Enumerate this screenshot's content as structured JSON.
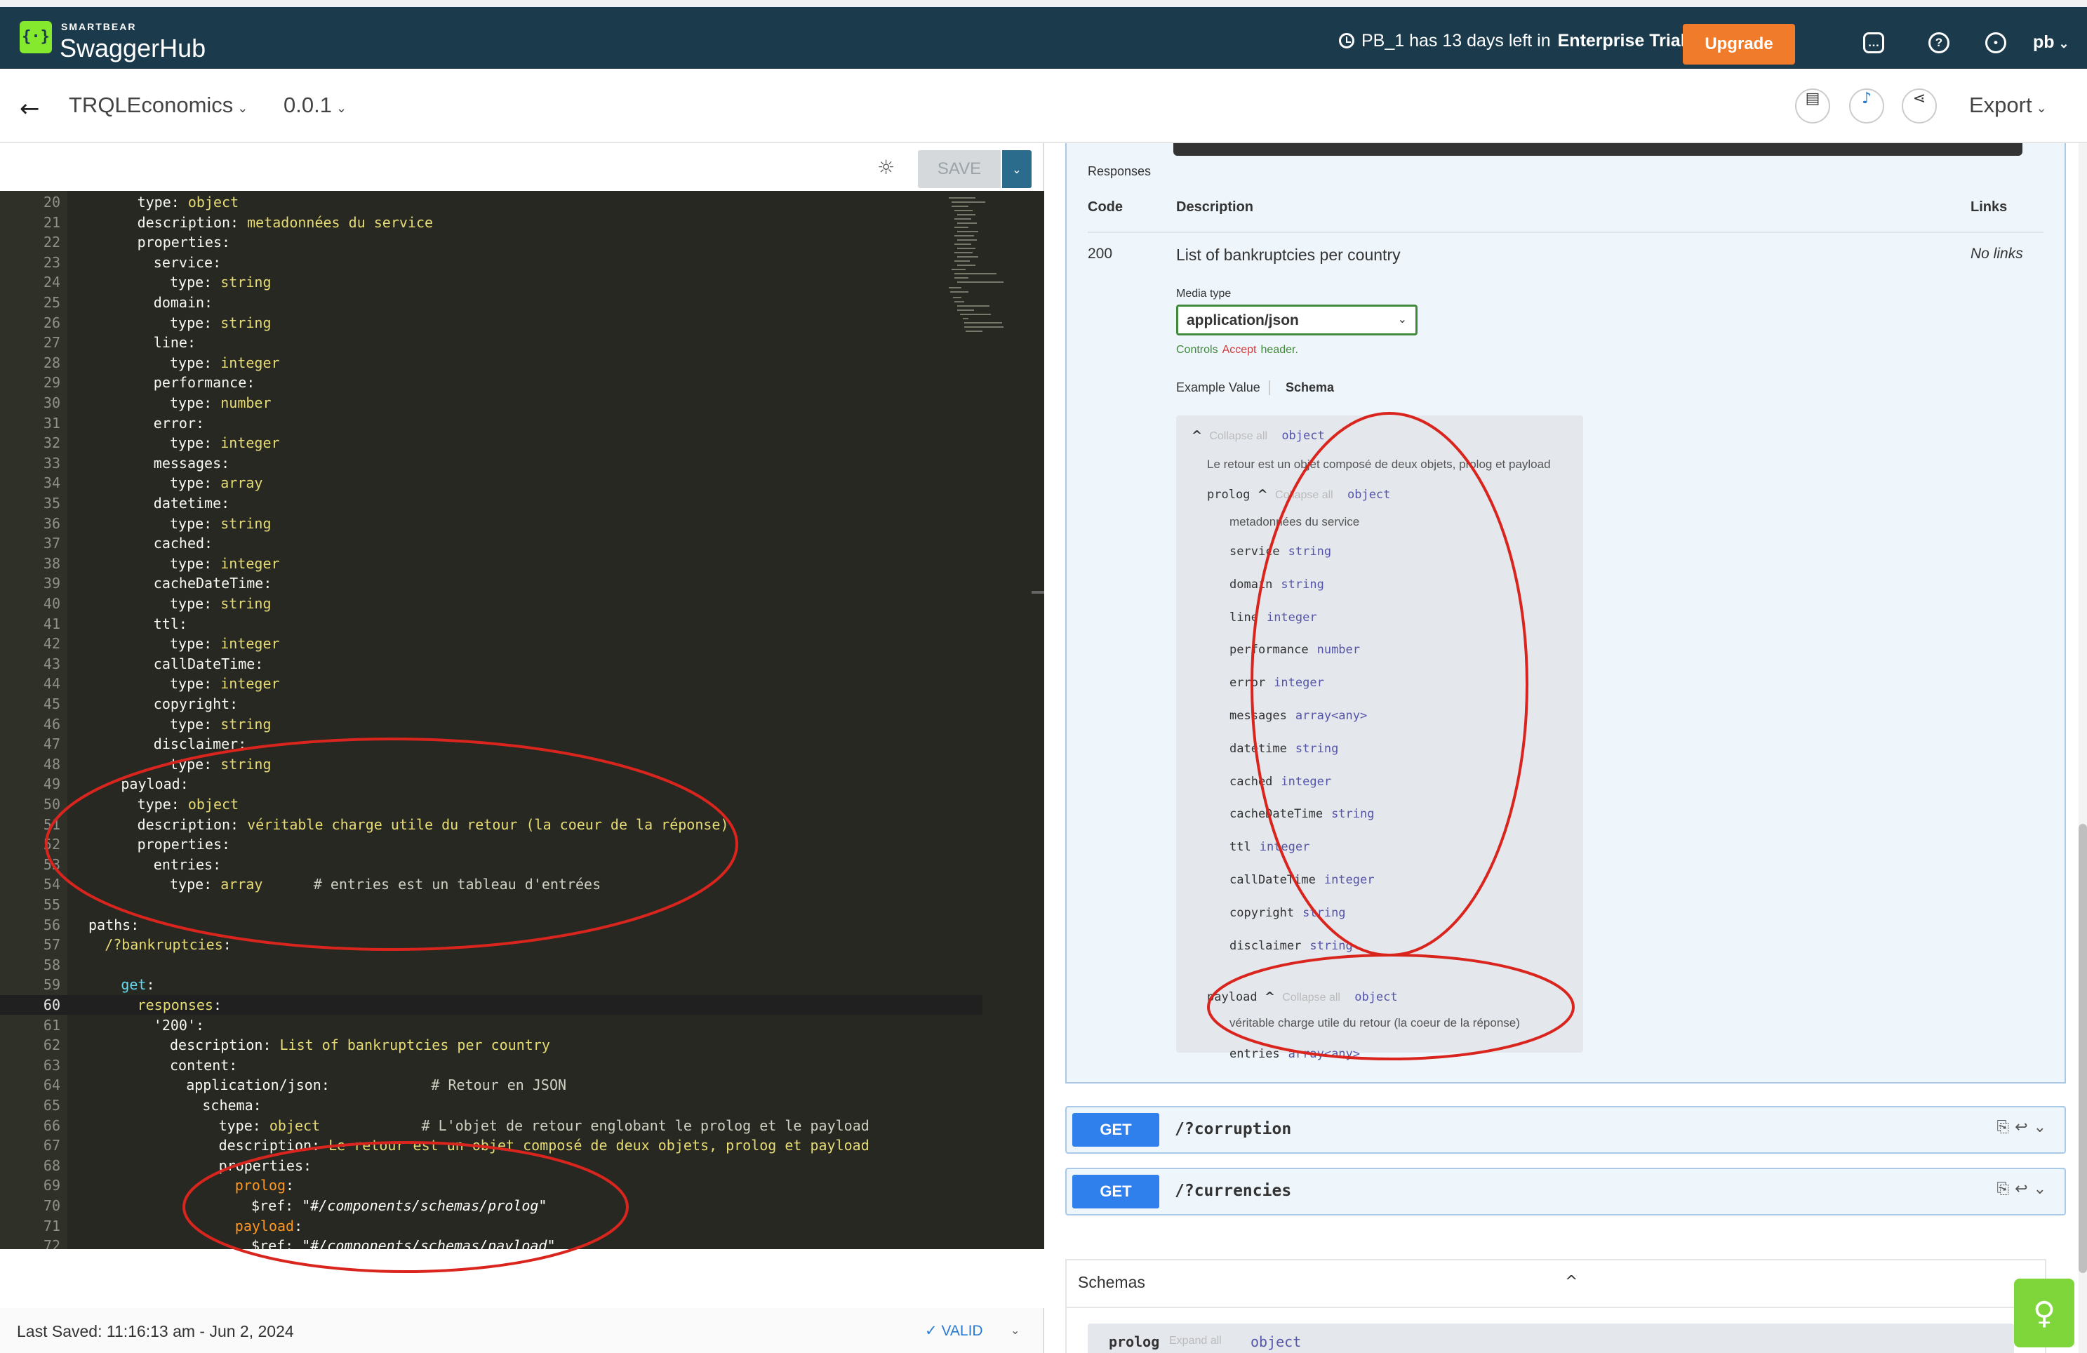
{
  "topbar": {
    "brand_top": "SMARTBEAR",
    "brand_main": "SwaggerHub",
    "trial_prefix": "PB_1 has 13 days left in",
    "trial_plan": "Enterprise Trial",
    "upgrade_label": "Upgrade",
    "user_name": "pb"
  },
  "subheader": {
    "api_name": "TRQLEconomics",
    "api_version": "0.0.1",
    "export_label": "Export"
  },
  "editor": {
    "save_label": "SAVE",
    "lines": [
      {
        "n": "20",
        "indent": 6,
        "parts": [
          {
            "t": "type",
            "c": "key"
          },
          {
            "t": ": "
          },
          {
            "t": "object",
            "c": "val"
          }
        ]
      },
      {
        "n": "21",
        "indent": 6,
        "parts": [
          {
            "t": "description",
            "c": "key"
          },
          {
            "t": ": "
          },
          {
            "t": "metadonnées du service",
            "c": "val"
          }
        ]
      },
      {
        "n": "22",
        "indent": 6,
        "parts": [
          {
            "t": "properties",
            "c": "key"
          },
          {
            "t": ":"
          }
        ]
      },
      {
        "n": "23",
        "indent": 8,
        "parts": [
          {
            "t": "service",
            "c": "key"
          },
          {
            "t": ":"
          }
        ]
      },
      {
        "n": "24",
        "indent": 10,
        "parts": [
          {
            "t": "type",
            "c": "key"
          },
          {
            "t": ": "
          },
          {
            "t": "string",
            "c": "val"
          }
        ]
      },
      {
        "n": "25",
        "indent": 8,
        "parts": [
          {
            "t": "domain",
            "c": "key"
          },
          {
            "t": ":"
          }
        ]
      },
      {
        "n": "26",
        "indent": 10,
        "parts": [
          {
            "t": "type",
            "c": "key"
          },
          {
            "t": ": "
          },
          {
            "t": "string",
            "c": "val"
          }
        ]
      },
      {
        "n": "27",
        "indent": 8,
        "parts": [
          {
            "t": "line",
            "c": "key"
          },
          {
            "t": ":"
          }
        ]
      },
      {
        "n": "28",
        "indent": 10,
        "parts": [
          {
            "t": "type",
            "c": "key"
          },
          {
            "t": ": "
          },
          {
            "t": "integer",
            "c": "val"
          }
        ]
      },
      {
        "n": "29",
        "indent": 8,
        "parts": [
          {
            "t": "performance",
            "c": "key"
          },
          {
            "t": ":"
          }
        ]
      },
      {
        "n": "30",
        "indent": 10,
        "parts": [
          {
            "t": "type",
            "c": "key"
          },
          {
            "t": ": "
          },
          {
            "t": "number",
            "c": "val"
          }
        ]
      },
      {
        "n": "31",
        "indent": 8,
        "parts": [
          {
            "t": "error",
            "c": "key"
          },
          {
            "t": ":"
          }
        ]
      },
      {
        "n": "32",
        "indent": 10,
        "parts": [
          {
            "t": "type",
            "c": "key"
          },
          {
            "t": ": "
          },
          {
            "t": "integer",
            "c": "val"
          }
        ]
      },
      {
        "n": "33",
        "indent": 8,
        "parts": [
          {
            "t": "messages",
            "c": "key"
          },
          {
            "t": ":"
          }
        ]
      },
      {
        "n": "34",
        "indent": 10,
        "parts": [
          {
            "t": "type",
            "c": "key"
          },
          {
            "t": ": "
          },
          {
            "t": "array",
            "c": "val"
          }
        ]
      },
      {
        "n": "35",
        "indent": 8,
        "parts": [
          {
            "t": "datetime",
            "c": "key"
          },
          {
            "t": ":"
          }
        ]
      },
      {
        "n": "36",
        "indent": 10,
        "parts": [
          {
            "t": "type",
            "c": "key"
          },
          {
            "t": ": "
          },
          {
            "t": "string",
            "c": "val"
          }
        ]
      },
      {
        "n": "37",
        "indent": 8,
        "parts": [
          {
            "t": "cached",
            "c": "key"
          },
          {
            "t": ":"
          }
        ]
      },
      {
        "n": "38",
        "indent": 10,
        "parts": [
          {
            "t": "type",
            "c": "key"
          },
          {
            "t": ": "
          },
          {
            "t": "integer",
            "c": "val"
          }
        ]
      },
      {
        "n": "39",
        "indent": 8,
        "parts": [
          {
            "t": "cacheDateTime",
            "c": "key"
          },
          {
            "t": ":"
          }
        ]
      },
      {
        "n": "40",
        "indent": 10,
        "parts": [
          {
            "t": "type",
            "c": "key"
          },
          {
            "t": ": "
          },
          {
            "t": "string",
            "c": "val"
          }
        ]
      },
      {
        "n": "41",
        "indent": 8,
        "parts": [
          {
            "t": "ttl",
            "c": "key"
          },
          {
            "t": ":"
          }
        ]
      },
      {
        "n": "42",
        "indent": 10,
        "parts": [
          {
            "t": "type",
            "c": "key"
          },
          {
            "t": ": "
          },
          {
            "t": "integer",
            "c": "val"
          }
        ]
      },
      {
        "n": "43",
        "indent": 8,
        "parts": [
          {
            "t": "callDateTime",
            "c": "key"
          },
          {
            "t": ":"
          }
        ]
      },
      {
        "n": "44",
        "indent": 10,
        "parts": [
          {
            "t": "type",
            "c": "key"
          },
          {
            "t": ": "
          },
          {
            "t": "integer",
            "c": "val"
          }
        ]
      },
      {
        "n": "45",
        "indent": 8,
        "parts": [
          {
            "t": "copyright",
            "c": "key"
          },
          {
            "t": ":"
          }
        ]
      },
      {
        "n": "46",
        "indent": 10,
        "parts": [
          {
            "t": "type",
            "c": "key"
          },
          {
            "t": ": "
          },
          {
            "t": "string",
            "c": "val"
          }
        ]
      },
      {
        "n": "47",
        "indent": 8,
        "parts": [
          {
            "t": "disclaimer",
            "c": "key"
          },
          {
            "t": ":"
          }
        ]
      },
      {
        "n": "48",
        "indent": 10,
        "parts": [
          {
            "t": "type",
            "c": "key"
          },
          {
            "t": ": "
          },
          {
            "t": "string",
            "c": "val"
          }
        ]
      },
      {
        "n": "49",
        "indent": 4,
        "parts": [
          {
            "t": "payload",
            "c": "key"
          },
          {
            "t": ":"
          }
        ]
      },
      {
        "n": "50",
        "indent": 6,
        "parts": [
          {
            "t": "type",
            "c": "key"
          },
          {
            "t": ": "
          },
          {
            "t": "object",
            "c": "val"
          }
        ]
      },
      {
        "n": "51",
        "indent": 6,
        "parts": [
          {
            "t": "description",
            "c": "key"
          },
          {
            "t": ": "
          },
          {
            "t": "véritable charge utile du retour (la coeur de la réponse)",
            "c": "val"
          }
        ]
      },
      {
        "n": "52",
        "indent": 6,
        "parts": [
          {
            "t": "properties",
            "c": "key"
          },
          {
            "t": ":"
          }
        ]
      },
      {
        "n": "53",
        "indent": 8,
        "parts": [
          {
            "t": "entries",
            "c": "key"
          },
          {
            "t": ":"
          }
        ]
      },
      {
        "n": "54",
        "indent": 10,
        "parts": [
          {
            "t": "type",
            "c": "key"
          },
          {
            "t": ": "
          },
          {
            "t": "array",
            "c": "val"
          },
          {
            "t": "      # entries est un tableau d'entrées",
            "c": "cm"
          }
        ]
      },
      {
        "n": "55",
        "indent": 0,
        "parts": []
      },
      {
        "n": "56",
        "indent": 0,
        "parts": [
          {
            "t": "paths",
            "c": "key"
          },
          {
            "t": ":"
          }
        ]
      },
      {
        "n": "57",
        "indent": 2,
        "parts": [
          {
            "t": "/?bankruptcies",
            "c": "val"
          },
          {
            "t": ":"
          }
        ]
      },
      {
        "n": "58",
        "indent": 0,
        "parts": []
      },
      {
        "n": "59",
        "indent": 4,
        "parts": [
          {
            "t": "get",
            "c": "verb"
          },
          {
            "t": ":"
          }
        ]
      },
      {
        "n": "60",
        "indent": 6,
        "parts": [
          {
            "t": "responses",
            "c": "val"
          },
          {
            "t": ":"
          }
        ]
      },
      {
        "n": "61",
        "indent": 8,
        "parts": [
          {
            "t": "'200'",
            "c": "key"
          },
          {
            "t": ":"
          }
        ]
      },
      {
        "n": "62",
        "indent": 10,
        "parts": [
          {
            "t": "description",
            "c": "key"
          },
          {
            "t": ": "
          },
          {
            "t": "List of bankruptcies per country",
            "c": "val"
          }
        ]
      },
      {
        "n": "63",
        "indent": 10,
        "parts": [
          {
            "t": "content",
            "c": "key"
          },
          {
            "t": ":"
          }
        ]
      },
      {
        "n": "64",
        "indent": 12,
        "parts": [
          {
            "t": "application/json",
            "c": "key"
          },
          {
            "t": ":"
          },
          {
            "t": "            # Retour en JSON",
            "c": "cm"
          }
        ]
      },
      {
        "n": "65",
        "indent": 14,
        "parts": [
          {
            "t": "schema",
            "c": "key"
          },
          {
            "t": ":"
          }
        ]
      },
      {
        "n": "66",
        "indent": 16,
        "parts": [
          {
            "t": "type",
            "c": "key"
          },
          {
            "t": ": "
          },
          {
            "t": "object",
            "c": "val"
          },
          {
            "t": "            # L'objet de retour englobant le prolog et le payload",
            "c": "cm"
          }
        ]
      },
      {
        "n": "67",
        "indent": 16,
        "parts": [
          {
            "t": "description",
            "c": "key"
          },
          {
            "t": ": "
          },
          {
            "t": "Le retour est un objet composé de deux objets, prolog et payload",
            "c": "val"
          }
        ]
      },
      {
        "n": "68",
        "indent": 16,
        "parts": [
          {
            "t": "properties",
            "c": "key"
          },
          {
            "t": ":"
          }
        ]
      },
      {
        "n": "69",
        "indent": 18,
        "parts": [
          {
            "t": "prolog",
            "c": "ref-key"
          },
          {
            "t": ":"
          }
        ]
      },
      {
        "n": "70",
        "indent": 20,
        "parts": [
          {
            "t": "$ref",
            "c": "key"
          },
          {
            "t": ": "
          },
          {
            "t": "\"#/components/schemas/prolog\"",
            "c": "ref-str"
          }
        ]
      },
      {
        "n": "71",
        "indent": 18,
        "parts": [
          {
            "t": "payload",
            "c": "ref-key"
          },
          {
            "t": ":"
          }
        ]
      },
      {
        "n": "72",
        "indent": 20,
        "parts": [
          {
            "t": "$ref",
            "c": "key"
          },
          {
            "t": ": "
          },
          {
            "t": "\"#/components/schemas/payload\"",
            "c": "ref-str"
          }
        ]
      }
    ]
  },
  "footer": {
    "last_saved": "Last Saved:  11:16:13 am   -   Jun 2, 2024",
    "valid_label": "VALID"
  },
  "responses": {
    "section_label": "Responses",
    "col_code": "Code",
    "col_description": "Description",
    "col_links": "Links",
    "row_code": "200",
    "row_description": "List of bankruptcies per country",
    "row_links": "No links",
    "media_type_label": "Media type",
    "media_type_value": "application/json",
    "controls_prefix": "Controls",
    "controls_accept": "Accept",
    "controls_suffix": "header.",
    "tab_example": "Example Value",
    "tab_schema": "Schema"
  },
  "schema_tree": {
    "collapse_all": "Collapse all",
    "object_type": "object",
    "root_description": "Le retour est un objet composé de deux objets, prolog et payload",
    "prolog_name": "prolog",
    "prolog_description": "metadonnées du service",
    "prolog_props": [
      {
        "name": "service",
        "type": "string"
      },
      {
        "name": "domain",
        "type": "string"
      },
      {
        "name": "line",
        "type": "integer"
      },
      {
        "name": "performance",
        "type": "number"
      },
      {
        "name": "error",
        "type": "integer"
      },
      {
        "name": "messages",
        "type": "array<any>"
      },
      {
        "name": "datetime",
        "type": "string"
      },
      {
        "name": "cached",
        "type": "integer"
      },
      {
        "name": "cacheDateTime",
        "type": "string"
      },
      {
        "name": "ttl",
        "type": "integer"
      },
      {
        "name": "callDateTime",
        "type": "integer"
      },
      {
        "name": "copyright",
        "type": "string"
      },
      {
        "name": "disclaimer",
        "type": "string"
      }
    ],
    "payload_name": "payload",
    "payload_description": "véritable charge utile du retour (la coeur de la réponse)",
    "payload_props": [
      {
        "name": "entries",
        "type": "array<any>"
      }
    ]
  },
  "operations": [
    {
      "method": "GET",
      "path": "/?corruption"
    },
    {
      "method": "GET",
      "path": "/?currencies"
    }
  ],
  "schemas": {
    "title": "Schemas",
    "first_name": "prolog",
    "first_expand": "Expand all",
    "first_type": "object"
  }
}
